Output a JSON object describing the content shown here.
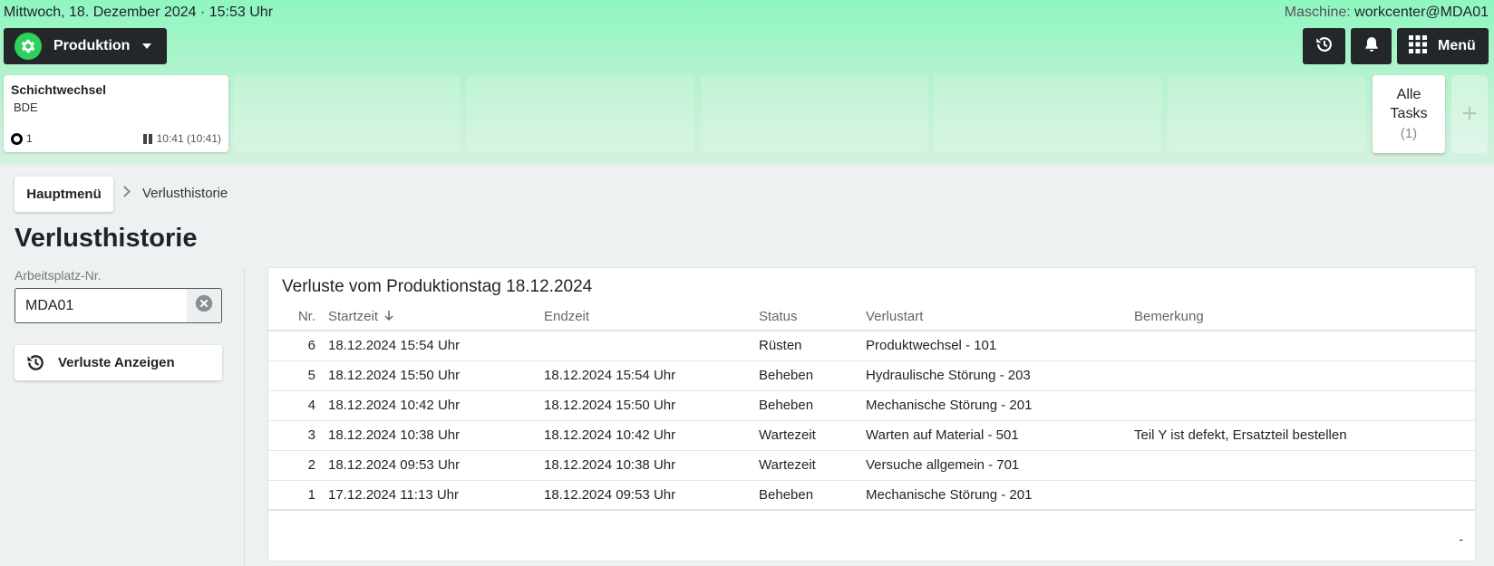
{
  "header": {
    "datetime": "Mittwoch, 18. Dezember 2024 · 15:53 Uhr",
    "machine_label": "Maschine:",
    "machine_value": "workcenter@MDA01",
    "mode_label": "Produktion",
    "menu_label": "Menü"
  },
  "tasks": {
    "card": {
      "title": "Schichtwechsel",
      "subtitle": "BDE",
      "count": "1",
      "time": "10:41 (10:41)"
    },
    "all_tasks_line1": "Alle",
    "all_tasks_line2": "Tasks",
    "all_tasks_count": "(1)",
    "add_label": "+"
  },
  "breadcrumb": {
    "home": "Hauptmenü",
    "current": "Verlusthistorie"
  },
  "page_title": "Verlusthistorie",
  "filter": {
    "label": "Arbeitsplatz-Nr.",
    "value": "MDA01",
    "button_label": "Verluste Anzeigen"
  },
  "panel": {
    "title": "Verluste vom Produktionstag 18.12.2024",
    "columns": [
      "Nr.",
      "Startzeit",
      "Endzeit",
      "Status",
      "Verlustart",
      "Bemerkung"
    ],
    "rows": [
      {
        "nr": "6",
        "start": "18.12.2024 15:54 Uhr",
        "end": "",
        "status": "Rüsten",
        "art": "Produktwechsel - 101",
        "note": ""
      },
      {
        "nr": "5",
        "start": "18.12.2024 15:50 Uhr",
        "end": "18.12.2024 15:54 Uhr",
        "status": "Beheben",
        "art": "Hydraulische Störung - 203",
        "note": ""
      },
      {
        "nr": "4",
        "start": "18.12.2024 10:42 Uhr",
        "end": "18.12.2024 15:50 Uhr",
        "status": "Beheben",
        "art": "Mechanische Störung - 201",
        "note": ""
      },
      {
        "nr": "3",
        "start": "18.12.2024 10:38 Uhr",
        "end": "18.12.2024 10:42 Uhr",
        "status": "Wartezeit",
        "art": "Warten auf Material - 501",
        "note": "Teil Y ist defekt, Ersatzteil bestellen"
      },
      {
        "nr": "2",
        "start": "18.12.2024 09:53 Uhr",
        "end": "18.12.2024 10:38 Uhr",
        "status": "Wartezeit",
        "art": "Versuche allgemein - 701",
        "note": ""
      },
      {
        "nr": "1",
        "start": "17.12.2024 11:13 Uhr",
        "end": "18.12.2024 09:53 Uhr",
        "status": "Beheben",
        "art": "Mechanische Störung - 201",
        "note": ""
      }
    ],
    "footer": "-"
  },
  "icons": {
    "mode": "gear-icon",
    "history": "history-icon",
    "bell": "bell-icon",
    "menu": "grid-icon",
    "clear": "clear-circle-icon",
    "sort": "arrow-down-icon",
    "chevron": "chevron-right-icon"
  },
  "colors": {
    "header_gradient_top": "#8ef7c0",
    "dark_button": "#23272a",
    "mode_accent": "#2fd05b"
  }
}
